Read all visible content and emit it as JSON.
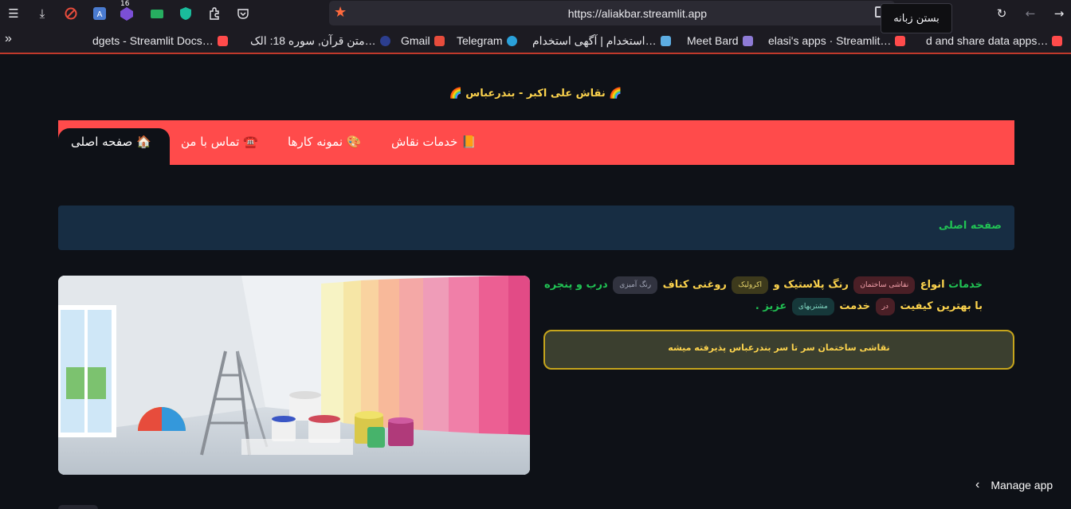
{
  "browser": {
    "url": "https://aliakbar.streamlit.app",
    "tooltip": "بستن زبانه",
    "extension_badge": "16",
    "bookmarks": [
      "d and share data apps…",
      "elasi's apps · Streamlit…",
      "Meet Bard",
      "استخدام | آگهی استخدام…",
      "Telegram",
      "Gmail",
      "متن قرآن, سوره 18: الک…",
      "dgets - Streamlit Docs…"
    ]
  },
  "site": {
    "title": "🌈 نقاش علی اکبر - بندرعباس 🌈"
  },
  "nav": {
    "home": "صفحه اصلی 🏠",
    "contact": "تماس با من ☎️",
    "portfolio": "نمونه کارها 🎨",
    "services": "خدمات نقاش 📙"
  },
  "info": {
    "text": "صفحه اصلی"
  },
  "content": {
    "line1": {
      "w1": "خدمات",
      "w2": "انواع",
      "tag1": "نقاشی ساختمان",
      "w3": "رنگ پلاستیک",
      "w4": "و",
      "tag2": "اکرولیک",
      "w5": "روغنی",
      "w6": "کناف",
      "tag3": "رنگ آمیزی",
      "w7": "درب و پنجره"
    },
    "line2": {
      "w1": "با بهترین کیفیت",
      "tag1": "در",
      "w2": "خدمت",
      "tag2": "مشتریهای",
      "w3": "عزیز ."
    },
    "notice": "نقاشی ساختمان سر تا سر بندرعباس پذیرفته میشه"
  },
  "footer": {
    "manage": "Manage app"
  },
  "colors": {
    "nav_bg": "#ff4b4b",
    "page_bg": "#0e1117",
    "accent_green": "#21c354",
    "accent_yellow": "#fcd34d"
  }
}
